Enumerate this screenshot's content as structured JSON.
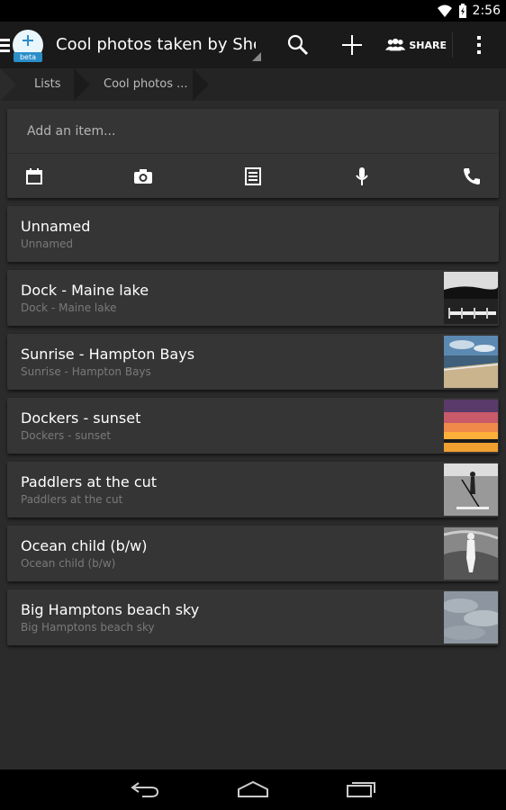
{
  "status_bar": {
    "time": "2:56"
  },
  "action_bar": {
    "app_badge": "beta",
    "title": "Cool photos taken by She",
    "share_label": "SHARE"
  },
  "breadcrumb": {
    "items": [
      "Lists",
      "Cool photos ..."
    ]
  },
  "add_item": {
    "placeholder": "Add an item...",
    "tools": [
      "calendar-icon",
      "camera-icon",
      "note-icon",
      "microphone-icon",
      "phone-icon"
    ]
  },
  "items": [
    {
      "title": "Unnamed",
      "subtitle": "Unnamed",
      "thumb": null
    },
    {
      "title": "Dock - Maine lake",
      "subtitle": "Dock - Maine lake",
      "thumb": "bw-dock"
    },
    {
      "title": "Sunrise - Hampton Bays",
      "subtitle": "Sunrise - Hampton Bays",
      "thumb": "beach"
    },
    {
      "title": "Dockers - sunset",
      "subtitle": "Dockers - sunset",
      "thumb": "sunset"
    },
    {
      "title": "Paddlers at the cut",
      "subtitle": "Paddlers at the cut",
      "thumb": "bw-paddler"
    },
    {
      "title": "Ocean child (b/w)",
      "subtitle": "Ocean child (b/w)",
      "thumb": "bw-child"
    },
    {
      "title": "Big Hamptons beach sky",
      "subtitle": "Big Hamptons beach sky",
      "thumb": "sky"
    }
  ],
  "colors": {
    "accent": "#2a8ec9",
    "card": "#353535",
    "background": "#2b2b2b"
  }
}
